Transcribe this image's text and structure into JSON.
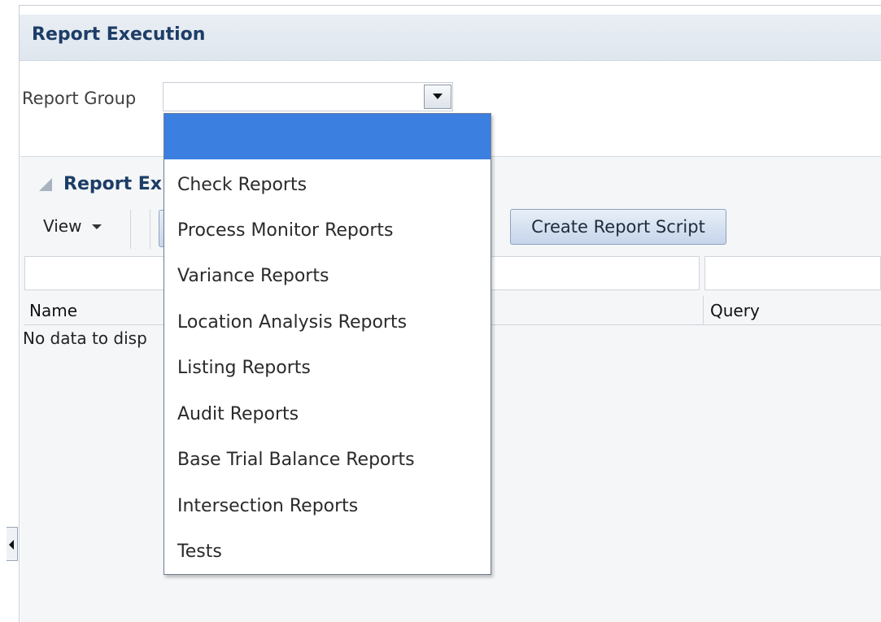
{
  "page": {
    "title": "Report Execution"
  },
  "report_group": {
    "label": "Report Group",
    "selected_value": ""
  },
  "dropdown": {
    "options": [
      "",
      "Check Reports",
      "Process Monitor Reports",
      "Variance Reports",
      "Location Analysis Reports",
      "Listing Reports",
      "Audit Reports",
      "Base Trial Balance Reports",
      "Intersection Reports",
      "Tests"
    ],
    "highlighted_index": 0,
    "highlight_color": "#3b7fe0"
  },
  "panel": {
    "title": "Report Ex"
  },
  "toolbar": {
    "view_label": "View",
    "create_button_label": "Create Report Script"
  },
  "table": {
    "columns": [
      "Name",
      "Query"
    ],
    "empty_text": "No data to disp"
  },
  "colors": {
    "title_text": "#1d3d66",
    "header_band": "#e3e9f0",
    "button_bg": "#c5d5ea"
  },
  "icons": {
    "select_arrow": "triangle-down-icon",
    "panel_toggle": "collapse-triangle-icon",
    "view_menu": "caret-down-icon",
    "side_handle": "triangle-left-icon"
  }
}
